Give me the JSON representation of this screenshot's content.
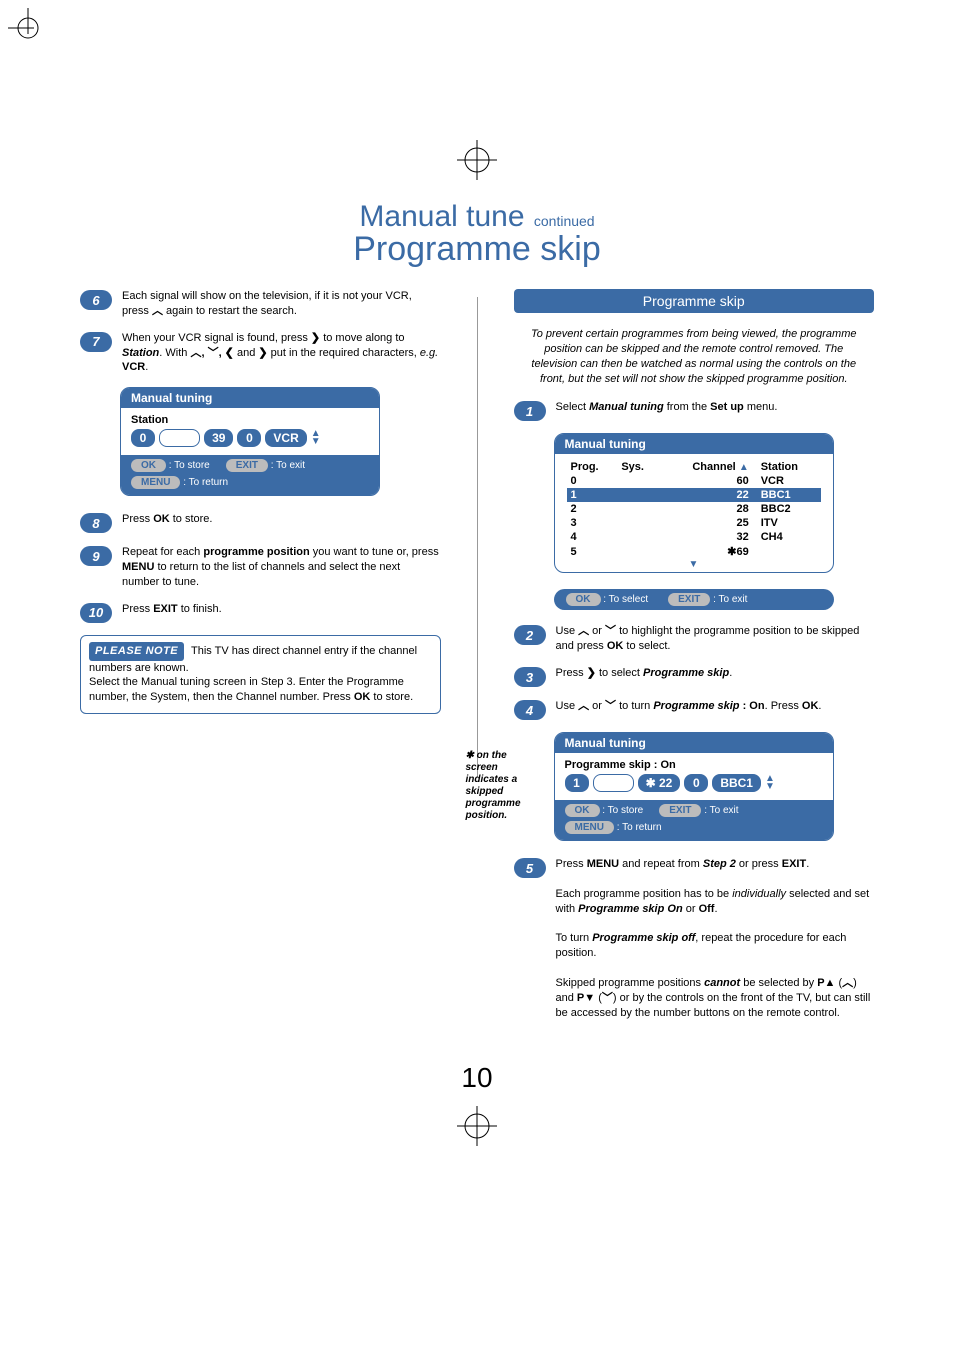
{
  "title": {
    "subtitle": "Manual tune",
    "continued": "continued",
    "main": "Programme skip"
  },
  "left": {
    "step6": {
      "num": "6",
      "text_a": "Each signal will show on the television, if it is not your VCR, press ",
      "text_b": " again to restart the search."
    },
    "step7": {
      "num": "7",
      "text_a": "When your VCR signal is found, press ",
      "text_b": " to move along to ",
      "station_word": "Station",
      "text_c": ". With ",
      "text_d": " put in the required characters, ",
      "eg": "e.g.",
      "vcr": " VCR",
      "text_e": "."
    },
    "osd1": {
      "header": "Manual tuning",
      "row_label": "Station",
      "v1": "0",
      "v2": "",
      "v3": "39",
      "v4": "0",
      "v5": "VCR",
      "ok": "OK",
      "ok_lbl": ": To store",
      "exit": "EXIT",
      "exit_lbl": ": To exit",
      "menu": "MENU",
      "menu_lbl": ": To return"
    },
    "step8": {
      "num": "8",
      "text_a": "Press ",
      "ok": "OK",
      "text_b": " to store."
    },
    "step9": {
      "num": "9",
      "text_a": "Repeat for each ",
      "pp": "programme position",
      "text_b": " you want to tune or, press ",
      "menu": "MENU",
      "text_c": " to return to the list of channels and select the next number to tune."
    },
    "step10": {
      "num": "10",
      "text_a": "Press ",
      "exit": "EXIT",
      "text_b": " to finish."
    },
    "note": {
      "badge": "PLEASE NOTE",
      "line1": "This TV has direct channel entry if the channel numbers are known.",
      "line2_a": "Select the ",
      "mt": "Manual tuning",
      "line2_b": " screen in ",
      "step3": "Step 3",
      "line2_c": ". Enter the ",
      "pn": "Programme number",
      "line2_d": ", the ",
      "sys": "System",
      "line2_e": ", then the ",
      "ch": "Channel",
      "line2_f": " number. Press ",
      "ok": "OK",
      "line2_g": " to store."
    }
  },
  "right": {
    "section_header": "Programme skip",
    "intro": "To prevent certain programmes from being viewed, the programme position can be skipped and the remote control removed. The television can then be watched as normal using the controls on the front, but the set will not show the skipped programme position.",
    "step1": {
      "num": "1",
      "text_a": "Select ",
      "mt": "Manual tuning",
      "text_b": " from the ",
      "setup": "Set up",
      "text_c": " menu."
    },
    "osd_table": {
      "header": "Manual tuning",
      "cols": {
        "prog": "Prog.",
        "sys": "Sys.",
        "channel": "Channel",
        "station": "Station"
      },
      "rows": [
        {
          "prog": "0",
          "sys": "",
          "channel": "60",
          "station": "VCR",
          "hl": false
        },
        {
          "prog": "1",
          "sys": "",
          "channel": "22",
          "station": "BBC1",
          "hl": true
        },
        {
          "prog": "2",
          "sys": "",
          "channel": "28",
          "station": "BBC2",
          "hl": false
        },
        {
          "prog": "3",
          "sys": "",
          "channel": "25",
          "station": "ITV",
          "hl": false
        },
        {
          "prog": "4",
          "sys": "",
          "channel": "32",
          "station": "CH4",
          "hl": false
        },
        {
          "prog": "5",
          "sys": "",
          "channel": "69",
          "station": "",
          "hl": false,
          "ast": true
        }
      ],
      "footer": {
        "ok": "OK",
        "ok_lbl": ": To select",
        "exit": "EXIT",
        "exit_lbl": ": To exit"
      }
    },
    "step2": {
      "num": "2",
      "text_a": "Use ",
      "text_b": " or ",
      "text_c": " to highlight the programme position to be skipped and press ",
      "ok": "OK",
      "text_d": " to select."
    },
    "step3": {
      "num": "3",
      "text_a": "Press ",
      "text_b": " to select ",
      "ps": "Programme skip",
      "text_c": "."
    },
    "step4": {
      "num": "4",
      "text_a": "Use ",
      "text_b": " or ",
      "text_c": " to turn ",
      "ps": "Programme skip",
      "on": " : On",
      "text_d": ". Press ",
      "ok": "OK",
      "text_e": "."
    },
    "osd2": {
      "header": "Manual tuning",
      "row_label": "Programme skip : On",
      "v1": "1",
      "v2": "✱ 22",
      "v3": "0",
      "v4": "BBC1",
      "ok": "OK",
      "ok_lbl": ": To store",
      "exit": "EXIT",
      "exit_lbl": ": To exit",
      "menu": "MENU",
      "menu_lbl": ": To return"
    },
    "side_note": "✱ on the screen indicates a skipped programme position.",
    "step5": {
      "num": "5",
      "text_a": "Press ",
      "menu": "MENU",
      "text_b": " and repeat from ",
      "step2": "Step 2",
      "text_c": " or press ",
      "exit": "EXIT",
      "text_d": ".",
      "para2_a": "Each programme position has to be ",
      "indiv": "individually",
      "para2_b": " selected and set with ",
      "pson": "Programme skip On",
      "para2_c": " or ",
      "off": "Off",
      "para2_d": ".",
      "para3_a": "To turn ",
      "psoff": "Programme skip off",
      "para3_b": ", repeat the procedure for each position.",
      "para4_a": "Skipped programme positions ",
      "cannot": "cannot",
      "para4_b": " be selected by ",
      "pup": "P▲",
      "para4_c": " (",
      "para4_d": ") and ",
      "pdown": "P▼",
      "para4_e": " (",
      "para4_f": ") or by the controls on the front of the TV, but can still be accessed by the number buttons on the remote control."
    }
  },
  "page_number": "10"
}
